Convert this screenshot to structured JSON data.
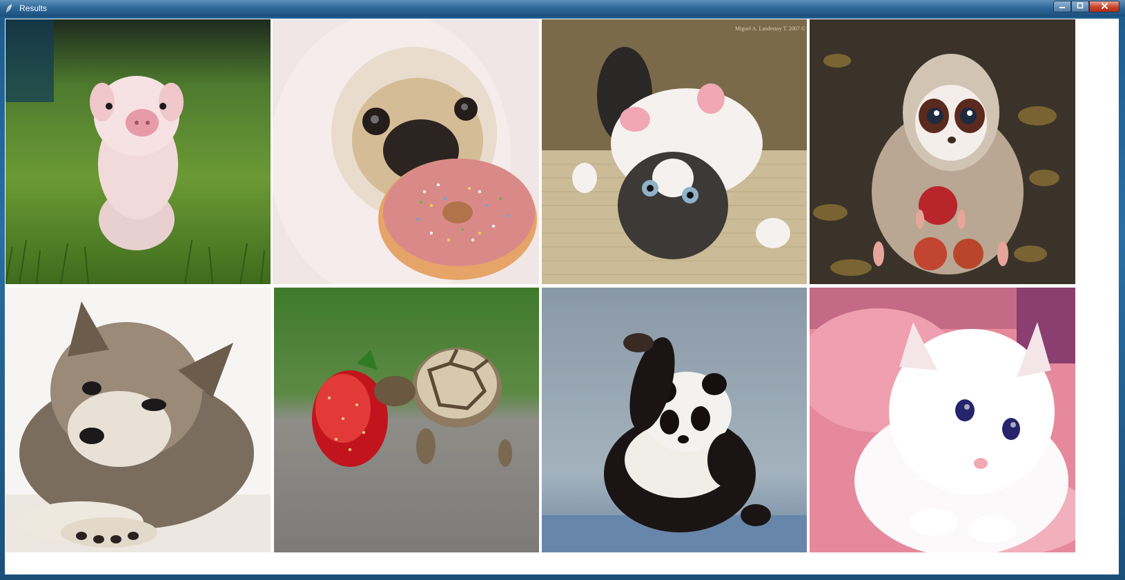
{
  "window": {
    "title": "Results",
    "controls": {
      "minimize_icon": "minimize-icon",
      "maximize_icon": "maximize-icon",
      "close_icon": "close-icon"
    }
  },
  "results": {
    "images": [
      {
        "subject": "piglet on grass",
        "icon": "piglet-photo"
      },
      {
        "subject": "pug in hoodie with sprinkled donut",
        "icon": "pug-donut-photo"
      },
      {
        "subject": "kitten upside down on carpet",
        "icon": "kitten-carpet-photo",
        "watermark": "Miguel A. Landestoy T. 2007 ©"
      },
      {
        "subject": "furry toy creature holding apples",
        "icon": "creature-apples-photo"
      },
      {
        "subject": "fluffy puppy lying down",
        "icon": "puppy-photo"
      },
      {
        "subject": "tortoise eating strawberry",
        "icon": "tortoise-strawberry-photo"
      },
      {
        "subject": "baby panda waving",
        "icon": "panda-photo"
      },
      {
        "subject": "white kitten on pink blanket",
        "icon": "white-kitten-photo"
      }
    ]
  },
  "colors": {
    "titlebar": "#2f6a9c",
    "frame": "#1b4f7a",
    "close_button": "#c6452c"
  }
}
